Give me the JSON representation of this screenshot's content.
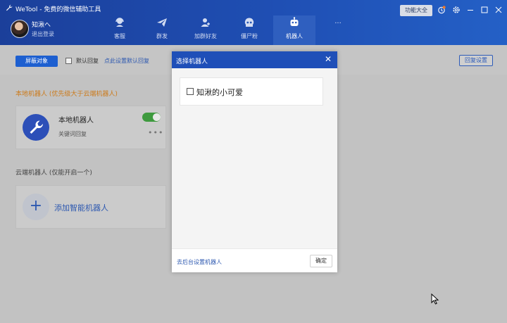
{
  "window": {
    "title": "WeTool - 免费的微信辅助工具",
    "feature_button": "功能大全"
  },
  "user": {
    "name": "知湫へ",
    "logout": "退出登录"
  },
  "nav": {
    "items": [
      {
        "label": "客服",
        "icon": "headset-icon"
      },
      {
        "label": "群发",
        "icon": "paper-plane-icon"
      },
      {
        "label": "加群好友",
        "icon": "add-user-icon"
      },
      {
        "label": "僵尸粉",
        "icon": "skull-icon"
      },
      {
        "label": "机器人",
        "icon": "robot-icon",
        "active": true
      },
      {
        "label": "···",
        "icon": "more-icon"
      }
    ]
  },
  "toolbar": {
    "shield_button": "屏蔽对象",
    "default_reply_label": "默认回复",
    "default_reply_link": "点此设置默认回复",
    "reply_settings": "回复设置"
  },
  "local_section": {
    "title": "本地机器人 (优先级大于云端机器人)",
    "card": {
      "name": "本地机器人",
      "subtitle": "关键词回复",
      "enabled": true
    }
  },
  "cloud_section": {
    "title": "云端机器人 (仅能开启一个)",
    "add_label": "添加智能机器人",
    "add_symbol": "+"
  },
  "dialog": {
    "title": "选择机器人",
    "close_symbol": "✕",
    "options": [
      {
        "name": "知湫的小可爱",
        "checked": false
      }
    ],
    "backend_link": "去后台设置机器人",
    "confirm_button": "确定"
  },
  "colors": {
    "header_blue": "#1f4fb4",
    "accent_blue": "#1d5fd0",
    "warning_orange": "#cc7a1a",
    "toggle_green": "#3e9a3e"
  }
}
